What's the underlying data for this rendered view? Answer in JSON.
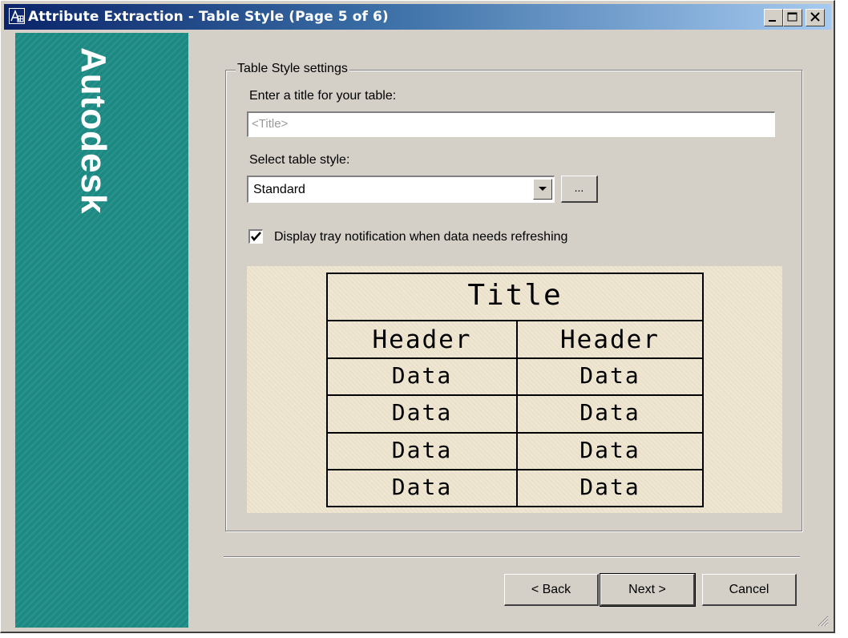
{
  "window": {
    "title": "Attribute Extraction - Table Style (Page 5 of 6)",
    "minimize_label": "_",
    "maximize_label": "□",
    "close_label": "×"
  },
  "banner": {
    "brand": "Autodesk"
  },
  "group": {
    "legend": "Table Style settings"
  },
  "title_field": {
    "label": "Enter a title for your table:",
    "placeholder": "<Title>",
    "value": ""
  },
  "style_select": {
    "label": "Select table style:",
    "value": "Standard",
    "browse_label": "..."
  },
  "tray_option": {
    "label": "Display tray notification when data needs refreshing",
    "checked": true
  },
  "preview": {
    "title": "Title",
    "headers": [
      "Header",
      "Header"
    ],
    "rows": [
      [
        "Data",
        "Data"
      ],
      [
        "Data",
        "Data"
      ],
      [
        "Data",
        "Data"
      ],
      [
        "Data",
        "Data"
      ]
    ]
  },
  "buttons": {
    "back": "< Back",
    "next": "Next >",
    "cancel": "Cancel"
  }
}
